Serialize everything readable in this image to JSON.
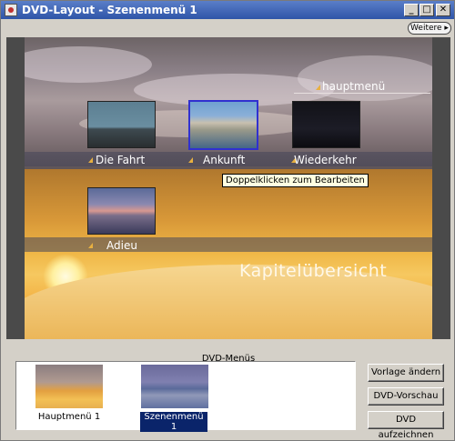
{
  "window": {
    "title": "DVD-Layout - Szenenmenü 1"
  },
  "toolbar": {
    "weitere_label": "Weitere ▸"
  },
  "menu": {
    "hauptmenu_label": "hauptmenü",
    "chapters": [
      {
        "label": "Die Fahrt"
      },
      {
        "label": "Ankunft"
      },
      {
        "label": "Wiederkehr"
      },
      {
        "label": "Adieu"
      }
    ],
    "kapitel_title": "Kapitelübersicht"
  },
  "tooltip": {
    "text": "Doppelklicken zum Bearbeiten"
  },
  "dvd_menus": {
    "section_label": "DVD-Menüs",
    "items": [
      {
        "label": "Hauptmenü 1"
      },
      {
        "label": "Szenenmenü 1"
      }
    ]
  },
  "buttons": {
    "vorlage": "Vorlage ändern",
    "vorschau": "DVD-Vorschau",
    "aufzeichnen": "DVD aufzeichnen"
  }
}
